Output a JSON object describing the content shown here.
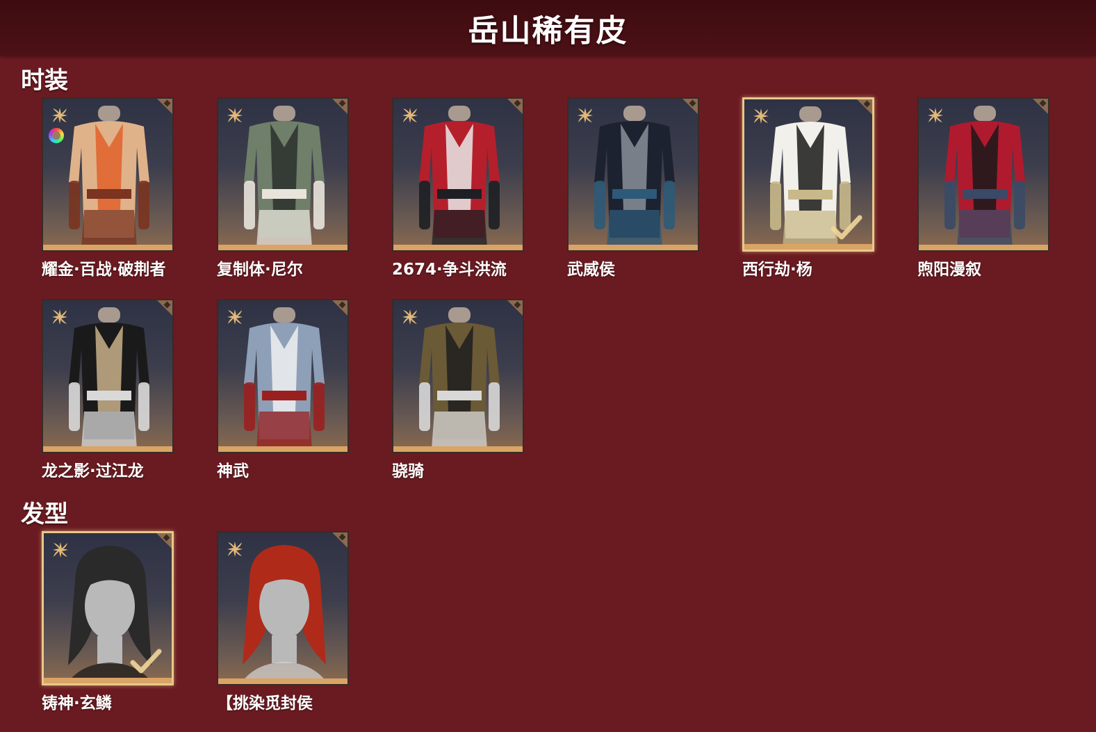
{
  "header": {
    "title": "岳山稀有皮"
  },
  "sections": {
    "outfits": {
      "title": "时装",
      "items": [
        {
          "name": "耀金·百战·破荆者",
          "selected": false,
          "palette": [
            "#e0b28a",
            "#e0602a",
            "#7a3420"
          ],
          "has_ring": true
        },
        {
          "name": "复制体·尼尔",
          "selected": false,
          "palette": [
            "#6f7f6a",
            "#2b302b",
            "#e8e4dc"
          ]
        },
        {
          "name": "2674·争斗洪流",
          "selected": false,
          "palette": [
            "#b51f2b",
            "#e9e9e9",
            "#1d1f24"
          ]
        },
        {
          "name": "武威侯",
          "selected": false,
          "palette": [
            "#1d2230",
            "#8a8f99",
            "#2d5a78"
          ]
        },
        {
          "name": "西行劫·杨",
          "selected": true,
          "palette": [
            "#f2f0ea",
            "#1a1a1a",
            "#c8b98a"
          ]
        },
        {
          "name": "煦阳漫叙",
          "selected": false,
          "palette": [
            "#b01a2e",
            "#1a1a1a",
            "#3a4a66"
          ]
        },
        {
          "name": "龙之影·过江龙",
          "selected": false,
          "palette": [
            "#1a1a1a",
            "#c9b28a",
            "#d9d9d9"
          ]
        },
        {
          "name": "神武",
          "selected": false,
          "palette": [
            "#8ea0b8",
            "#f0f0f0",
            "#9a2020"
          ]
        },
        {
          "name": "骁骑",
          "selected": false,
          "palette": [
            "#6b5a36",
            "#1e1e1e",
            "#d8d8d8"
          ]
        }
      ]
    },
    "hair": {
      "title": "发型",
      "items": [
        {
          "name": "铸神·玄鳞",
          "selected": true,
          "palette": [
            "#2a2a2a",
            "#b9b9b9",
            "#151515"
          ]
        },
        {
          "name": "【挑染觅封侯",
          "selected": false,
          "palette": [
            "#b02a1a",
            "#b9b9b9",
            "#d8d8d8"
          ]
        }
      ]
    }
  },
  "colors": {
    "background": "#6a1b21",
    "header": "#3c0c10",
    "selected_border": "#e7c98a",
    "star": "#e3b979"
  },
  "icons": {
    "card_badge": "gold-four-petal-star-icon",
    "corner": "diamond-corner-icon",
    "selected_mark": "checkmark-icon"
  }
}
